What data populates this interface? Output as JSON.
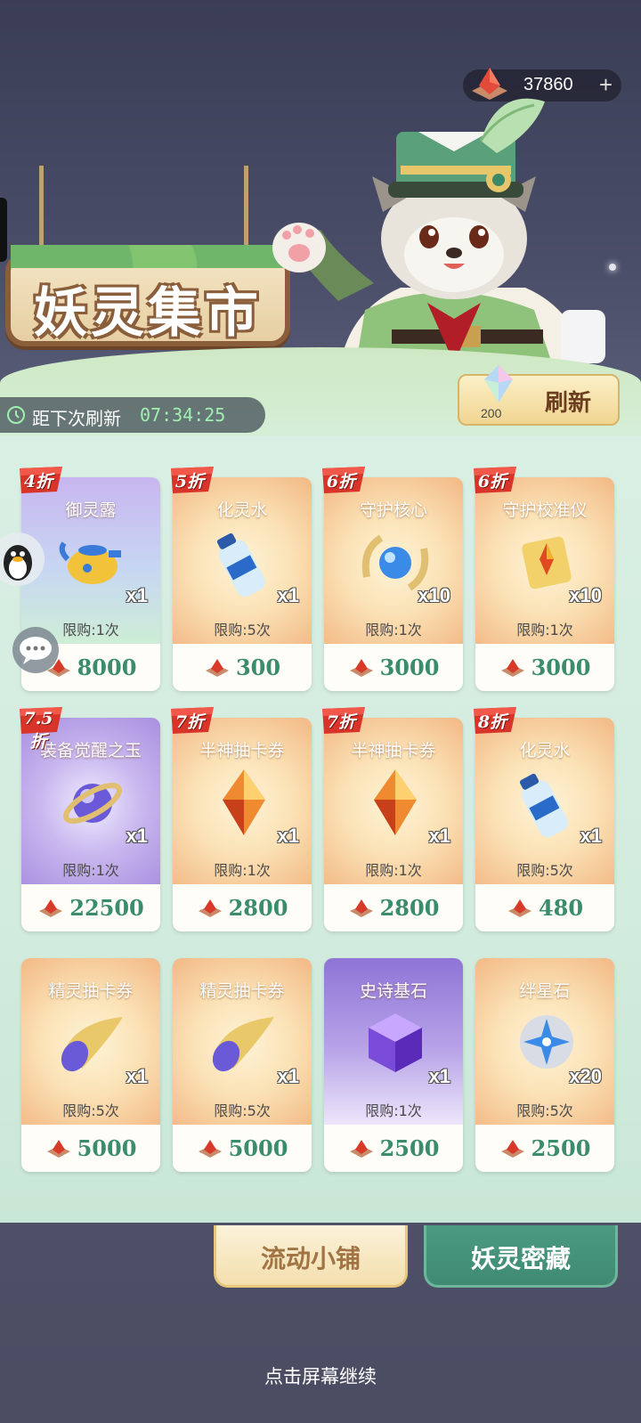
{
  "currency": {
    "value": "37860",
    "plus": "+"
  },
  "title": "妖灵集市",
  "countdown": {
    "label": "距下次刷新",
    "time": "07:34:25"
  },
  "refresh": {
    "cost": "200",
    "label": "刷新"
  },
  "items": [
    {
      "discount": "4折",
      "name": "御灵露",
      "qty": "x1",
      "limit": "限购:1次",
      "price": "8000"
    },
    {
      "discount": "5折",
      "name": "化灵水",
      "qty": "x1",
      "limit": "限购:5次",
      "price": "300"
    },
    {
      "discount": "6折",
      "name": "守护核心",
      "qty": "x10",
      "limit": "限购:1次",
      "price": "3000"
    },
    {
      "discount": "6折",
      "name": "守护校准仪",
      "qty": "x10",
      "limit": "限购:1次",
      "price": "3000"
    },
    {
      "discount": "7.5折",
      "name": "装备觉醒之玉",
      "qty": "x1",
      "limit": "限购:1次",
      "price": "22500"
    },
    {
      "discount": "7折",
      "name": "半神抽卡券",
      "qty": "x1",
      "limit": "限购:1次",
      "price": "2800"
    },
    {
      "discount": "7折",
      "name": "半神抽卡券",
      "qty": "x1",
      "limit": "限购:1次",
      "price": "2800"
    },
    {
      "discount": "8折",
      "name": "化灵水",
      "qty": "x1",
      "limit": "限购:5次",
      "price": "480"
    },
    {
      "discount": "",
      "name": "精灵抽卡券",
      "qty": "x1",
      "limit": "限购:5次",
      "price": "5000"
    },
    {
      "discount": "",
      "name": "精灵抽卡券",
      "qty": "x1",
      "limit": "限购:5次",
      "price": "5000"
    },
    {
      "discount": "",
      "name": "史诗基石",
      "qty": "x1",
      "limit": "限购:1次",
      "price": "2500"
    },
    {
      "discount": "",
      "name": "绊星石",
      "qty": "x20",
      "limit": "限购:5次",
      "price": "2500"
    }
  ],
  "tabs": {
    "active": "流动小铺",
    "other": "妖灵密藏"
  },
  "continue_hint": "点击屏幕继续"
}
